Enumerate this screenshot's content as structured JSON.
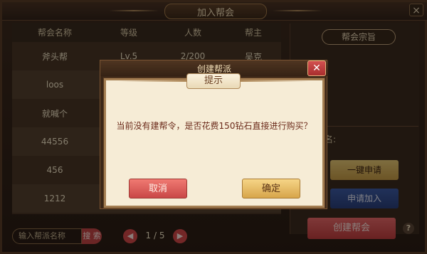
{
  "window": {
    "title": "加入帮会",
    "close_icon": "×"
  },
  "table": {
    "headers": [
      "帮会名称",
      "等级",
      "人数",
      "帮主"
    ],
    "rows": [
      {
        "name": "斧头帮",
        "level": "Lv.5",
        "members": "2/200",
        "leader": "吴克"
      },
      {
        "name": "loos"
      },
      {
        "name": "就喊个"
      },
      {
        "name": "44556"
      },
      {
        "name": "456"
      },
      {
        "name": "1212"
      }
    ]
  },
  "right_panel": {
    "purpose_label": "帮会宗旨",
    "name_label": "名:",
    "quick_apply": "一键申请",
    "apply_join": "申请加入",
    "create_guild": "创建帮会",
    "help": "?"
  },
  "search": {
    "placeholder": "输入帮派名称",
    "button": "搜 索"
  },
  "pagination": {
    "prev": "◀",
    "next": "▶",
    "text": "1 / 5"
  },
  "create_modal": {
    "title": "创建帮派",
    "close_icon": "✕"
  },
  "prompt": {
    "title": "提示",
    "message": "当前没有建帮令，是否花费150钻石直接进行购买？",
    "cancel": "取消",
    "confirm": "确定"
  }
}
